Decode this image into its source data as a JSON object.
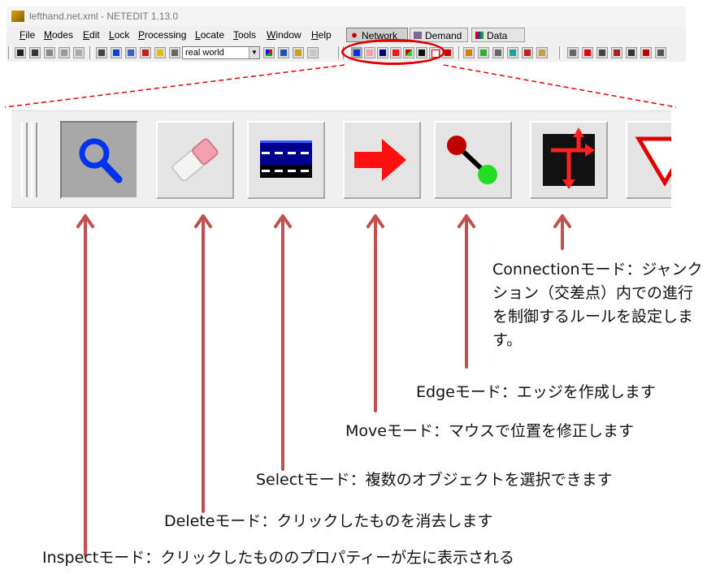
{
  "window": {
    "title": "lefthand.net.xml - NETEDIT 1.13.0",
    "menu": [
      "File",
      "Modes",
      "Edit",
      "Lock",
      "Processing",
      "Locate",
      "Tools",
      "Window",
      "Help"
    ],
    "supermode_tabs": [
      {
        "label": "Network",
        "active": true
      },
      {
        "label": "Demand",
        "active": false
      },
      {
        "label": "Data",
        "active": false
      }
    ],
    "view_scheme": "real world"
  },
  "zoom": {
    "buttons": [
      {
        "name": "inspect",
        "icon": "magnifier-icon",
        "active": true
      },
      {
        "name": "delete",
        "icon": "eraser-icon"
      },
      {
        "name": "select",
        "icon": "lane-select-icon"
      },
      {
        "name": "move",
        "icon": "right-arrow-icon"
      },
      {
        "name": "edge",
        "icon": "edge-nodes-icon"
      },
      {
        "name": "connection",
        "icon": "connection-icon"
      },
      {
        "name": "prohibition",
        "icon": "triangle-icon"
      }
    ]
  },
  "annotations": {
    "connection": "Connectionモード：ジャンクション（交差点）内での進行を制御するルールを設定します。",
    "edge": "Edgeモード：エッジを作成します",
    "move": "Moveモード：マウスで位置を修正します",
    "select": "Selectモード：複数のオブジェクトを選択できます",
    "delete": "Deleteモード：クリックしたものを消去します",
    "inspect": "Inspectモード：クリックしたもののプロパティーが左に表示される"
  },
  "colors": {
    "highlight": "#e00000",
    "arrow": "#c0504d",
    "inspect_icon": "#0033ee",
    "eraser": "#f2a0b0",
    "move_arrow": "#ff1010",
    "edge_start": "#c00000",
    "edge_end": "#22dd22",
    "connection_arrows": "#ff2020"
  }
}
